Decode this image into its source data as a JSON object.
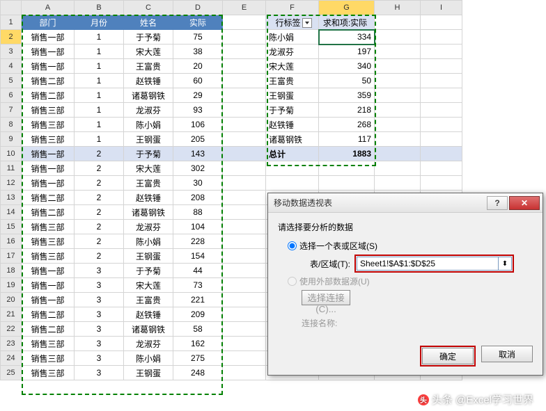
{
  "columns": [
    "A",
    "B",
    "C",
    "D",
    "E",
    "F",
    "G",
    "H",
    "I"
  ],
  "headers": [
    "部门",
    "月份",
    "姓名",
    "实际"
  ],
  "rows": [
    [
      "销售一部",
      "1",
      "于予菊",
      "75"
    ],
    [
      "销售一部",
      "1",
      "宋大莲",
      "38"
    ],
    [
      "销售一部",
      "1",
      "王富贵",
      "20"
    ],
    [
      "销售二部",
      "1",
      "赵铁锤",
      "60"
    ],
    [
      "销售二部",
      "1",
      "诸葛钢铁",
      "29"
    ],
    [
      "销售三部",
      "1",
      "龙淑芬",
      "93"
    ],
    [
      "销售三部",
      "1",
      "陈小娟",
      "106"
    ],
    [
      "销售三部",
      "1",
      "王钢蛋",
      "205"
    ],
    [
      "销售一部",
      "2",
      "于予菊",
      "143"
    ],
    [
      "销售一部",
      "2",
      "宋大莲",
      "302"
    ],
    [
      "销售一部",
      "2",
      "王富贵",
      "30"
    ],
    [
      "销售二部",
      "2",
      "赵铁锤",
      "208"
    ],
    [
      "销售二部",
      "2",
      "诸葛钢铁",
      "88"
    ],
    [
      "销售三部",
      "2",
      "龙淑芬",
      "104"
    ],
    [
      "销售三部",
      "2",
      "陈小娟",
      "228"
    ],
    [
      "销售三部",
      "2",
      "王钢蛋",
      "154"
    ],
    [
      "销售一部",
      "3",
      "于予菊",
      "44"
    ],
    [
      "销售一部",
      "3",
      "宋大莲",
      "73"
    ],
    [
      "销售一部",
      "3",
      "王富贵",
      "221"
    ],
    [
      "销售二部",
      "3",
      "赵铁锤",
      "209"
    ],
    [
      "销售二部",
      "3",
      "诸葛钢铁",
      "58"
    ],
    [
      "销售三部",
      "3",
      "龙淑芬",
      "162"
    ],
    [
      "销售三部",
      "3",
      "陈小娟",
      "275"
    ],
    [
      "销售三部",
      "3",
      "王钢蛋",
      "248"
    ]
  ],
  "pivot": {
    "row_label": "行标签",
    "value_label": "求和项:实际",
    "rows": [
      [
        "陈小娟",
        "334"
      ],
      [
        "龙淑芬",
        "197"
      ],
      [
        "宋大莲",
        "340"
      ],
      [
        "王富贵",
        "50"
      ],
      [
        "王钢蛋",
        "359"
      ],
      [
        "于予菊",
        "218"
      ],
      [
        "赵铁锤",
        "268"
      ],
      [
        "诸葛钢铁",
        "117"
      ]
    ],
    "total_label": "总计",
    "total_value": "1883"
  },
  "dialog": {
    "title": "移动数据透视表",
    "section_label": "请选择要分析的数据",
    "radio_range": "选择一个表或区域(S)",
    "field_label": "表/区域(T):",
    "field_value": "Sheet1!$A$1:$D$25",
    "radio_external": "使用外部数据源(U)",
    "choose_conn": "选择连接(C)...",
    "conn_name_label": "连接名称:",
    "ok": "确定",
    "cancel": "取消"
  },
  "watermark": "头条 @Excel学习世界"
}
